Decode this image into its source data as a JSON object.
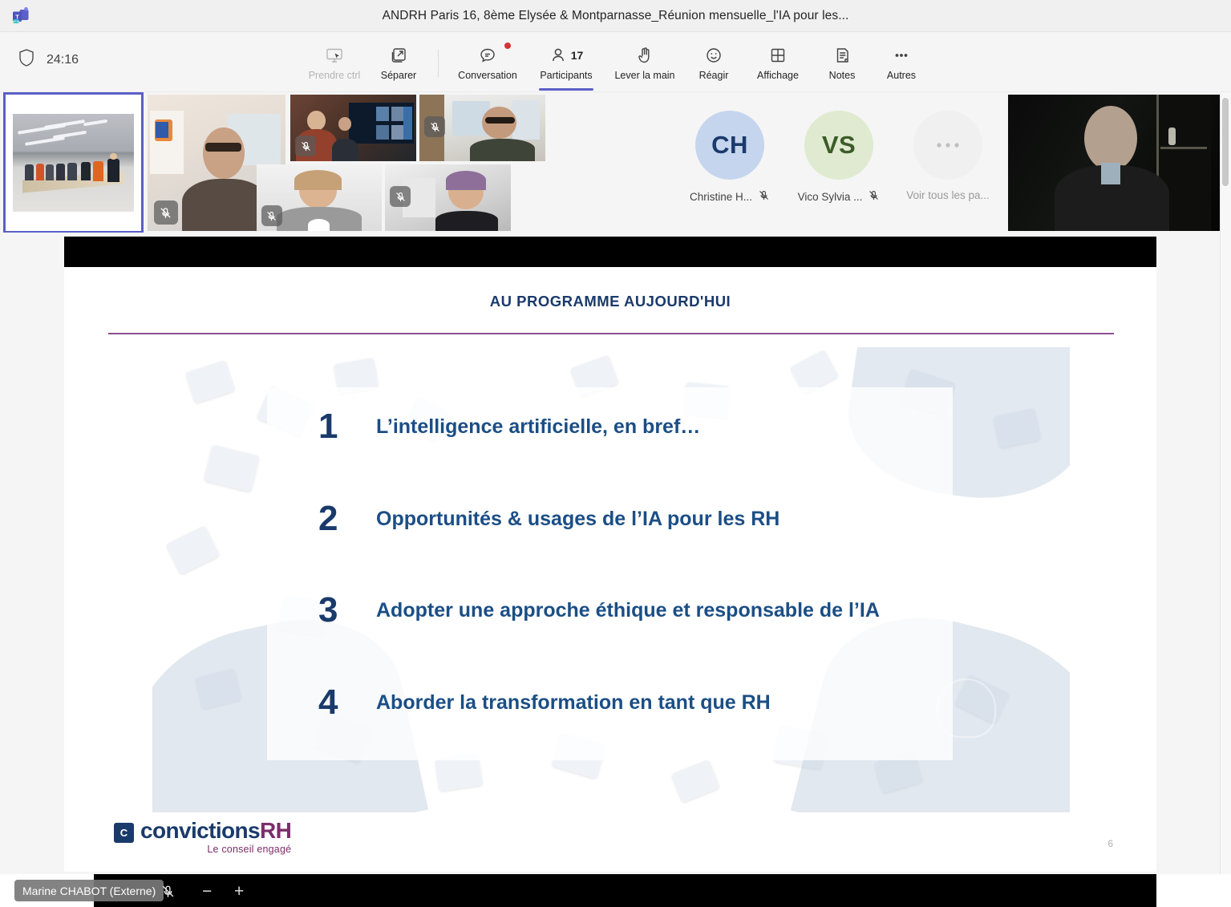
{
  "window": {
    "title": "ANDRH Paris 16, 8ème Elysée & Montparnasse_Réunion mensuelle_l'IA pour les...",
    "app_icon": "teams-icon"
  },
  "meeting": {
    "shield_icon": "shield-icon",
    "elapsed_time": "24:16"
  },
  "toolbar": {
    "items": [
      {
        "label": "Prendre ctrl",
        "icon": "take-control-icon",
        "disabled": true,
        "active": false
      },
      {
        "label": "Séparer",
        "icon": "pop-out-icon",
        "disabled": false,
        "active": false
      },
      {
        "label": "Conversation",
        "icon": "chat-icon",
        "disabled": false,
        "active": false,
        "has_notification": true
      },
      {
        "label": "Participants",
        "icon": "people-icon",
        "disabled": false,
        "active": true,
        "count": "17"
      },
      {
        "label": "Lever la main",
        "icon": "raise-hand-icon",
        "disabled": false,
        "active": false
      },
      {
        "label": "Réagir",
        "icon": "emoji-icon",
        "disabled": false,
        "active": false
      },
      {
        "label": "Affichage",
        "icon": "layout-grid-icon",
        "disabled": false,
        "active": false
      },
      {
        "label": "Notes",
        "icon": "notes-icon",
        "disabled": false,
        "active": false
      },
      {
        "label": "Autres",
        "icon": "more-ellipsis-icon",
        "disabled": false,
        "active": false
      }
    ]
  },
  "video_strip": {
    "tiles": [
      {
        "name": "conference-room",
        "scene": "room",
        "muted": false,
        "active_speaker": true
      },
      {
        "name": "participant-2",
        "scene": "office",
        "muted": true,
        "active_speaker": false
      },
      {
        "name": "participant-3",
        "scene": "meeting",
        "muted": true,
        "active_speaker": false
      },
      {
        "name": "participant-4",
        "scene": "modern",
        "muted": true,
        "active_speaker": false
      },
      {
        "name": "participant-5",
        "scene": "white",
        "muted": true,
        "active_speaker": false
      },
      {
        "name": "participant-6",
        "scene": "grey",
        "muted": true,
        "active_speaker": false
      },
      {
        "name": "participant-7",
        "scene": "dark",
        "muted": false,
        "active_speaker": false
      }
    ],
    "avatars": [
      {
        "initials": "CH",
        "label": "Christine H...",
        "muted": true,
        "bg": "#c5d5ee",
        "fg": "#1a3a6b"
      },
      {
        "initials": "VS",
        "label": "Vico Sylvia ...",
        "muted": true,
        "bg": "#dfead0",
        "fg": "#3d5c28"
      }
    ],
    "overflow": {
      "label": "Voir tous les pa...",
      "icon": "more-ellipsis-icon"
    }
  },
  "slide": {
    "title": "AU PROGRAMME AUJOURD'HUI",
    "agenda": [
      {
        "number": "1",
        "text": "L’intelligence artificielle, en bref…"
      },
      {
        "number": "2",
        "text": "Opportunités & usages de l’IA pour les RH"
      },
      {
        "number": "3",
        "text": "Adopter une approche éthique et responsable de l’IA"
      },
      {
        "number": "4",
        "text": "Aborder la transformation en tant que RH"
      }
    ],
    "logo": {
      "mark": "C",
      "main": "convictions",
      "accent": "RH",
      "tagline": "Le conseil engagé"
    },
    "page_number": "6"
  },
  "bottom_bar": {
    "presenter_name": "Marine CHABOT (Externe)",
    "mic_icon": "mic-muted-icon",
    "zoom_out_label": "−",
    "zoom_in_label": "+"
  },
  "colors": {
    "accent": "#5b5fc7",
    "slide_navy": "#1a3a6b",
    "slide_blue": "#1b4e85",
    "rule_purple": "#8c4f8c",
    "notification_red": "#d13438"
  }
}
